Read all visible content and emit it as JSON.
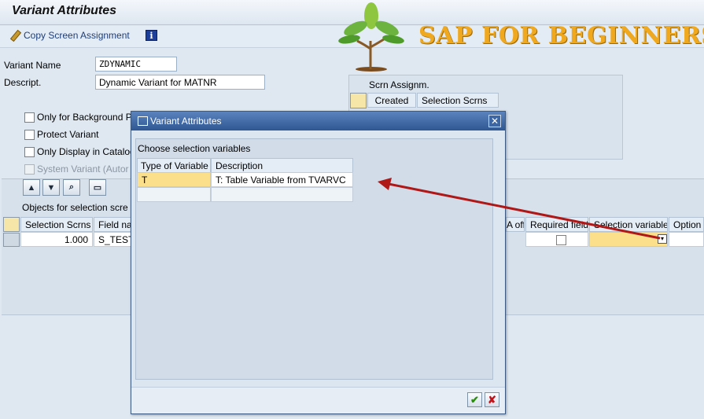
{
  "window": {
    "title": "Variant Attributes"
  },
  "toolbar": {
    "copy_label": "Copy Screen Assignment"
  },
  "logo": {
    "text": "SAP FOR BEGINNERS"
  },
  "form": {
    "variant_name_label": "Variant Name",
    "variant_name_value": "ZDYNAMIC",
    "descript_label": "Descript.",
    "descript_value": "Dynamic Variant for MATNR",
    "options": [
      {
        "label": "Only for Background P"
      },
      {
        "label": "Protect Variant"
      },
      {
        "label": "Only Display in Catalog"
      },
      {
        "label": "System Variant (Autor"
      }
    ]
  },
  "screen_assign": {
    "title": "Scrn Assignm.",
    "col_created": "Created",
    "col_selection": "Selection Scrns"
  },
  "objects": {
    "title": "Objects for selection scre",
    "columns": {
      "selection_scrns": "Selection Scrns",
      "field_name": "Field nar",
      "a_off": "A off",
      "required": "Required field",
      "selection_variable": "Selection variable",
      "option": "Option"
    },
    "row": {
      "selection_scrns": "1.000",
      "field_name": "S_TEST"
    }
  },
  "dialog": {
    "title": "Variant Attributes",
    "heading": "Choose selection variables",
    "col_type": "Type of Variable",
    "col_description": "Description",
    "rows": [
      {
        "type": "T",
        "description": "T: Table Variable from TVARVC"
      }
    ]
  },
  "colors": {
    "arrow": "#b01818",
    "accent_yellow": "#fbdf8a"
  }
}
